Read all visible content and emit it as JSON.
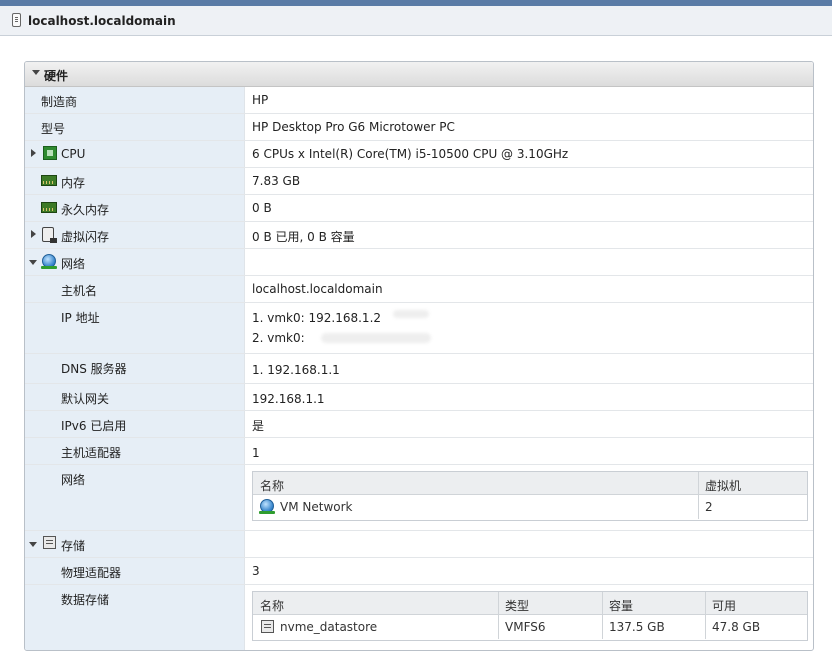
{
  "window": {
    "title": "localhost.localdomain"
  },
  "hardware": {
    "section_label": "硬件",
    "manufacturer": {
      "label": "制造商",
      "value": "HP"
    },
    "model": {
      "label": "型号",
      "value": "HP Desktop Pro G6 Microtower PC"
    },
    "cpu": {
      "label": "CPU",
      "value": "6 CPUs x Intel(R) Core(TM) i5-10500 CPU @ 3.10GHz"
    },
    "memory": {
      "label": "内存",
      "value": "7.83 GB"
    },
    "persistent_memory": {
      "label": "永久内存",
      "value": "0 B"
    },
    "virtual_flash": {
      "label": "虚拟闪存",
      "value": "0 B 已用, 0 B 容量"
    },
    "network": {
      "label": "网络",
      "hostname": {
        "label": "主机名",
        "value": "localhost.localdomain"
      },
      "ip": {
        "label": "IP 地址",
        "line1": "1. vmk0: 192.168.1.2",
        "line2": "2. vmk0:"
      },
      "dns": {
        "label": "DNS 服务器",
        "value": "1. 192.168.1.1"
      },
      "gateway": {
        "label": "默认网关",
        "value": "192.168.1.1"
      },
      "ipv6": {
        "label": "IPv6 已启用",
        "value": "是"
      },
      "host_adapters": {
        "label": "主机适配器",
        "value": "1"
      },
      "networks": {
        "label": "网络",
        "col_name": "名称",
        "col_vms": "虚拟机",
        "rows": [
          {
            "name": "VM Network",
            "vms": "2"
          }
        ]
      }
    },
    "storage": {
      "label": "存储",
      "physical_adapters": {
        "label": "物理适配器",
        "value": "3"
      },
      "datastores": {
        "label": "数据存储",
        "col_name": "名称",
        "col_type": "类型",
        "col_capacity": "容量",
        "col_free": "可用",
        "rows": [
          {
            "name": "nvme_datastore",
            "type": "VMFS6",
            "capacity": "137.5 GB",
            "free": "47.8 GB"
          }
        ]
      }
    }
  }
}
